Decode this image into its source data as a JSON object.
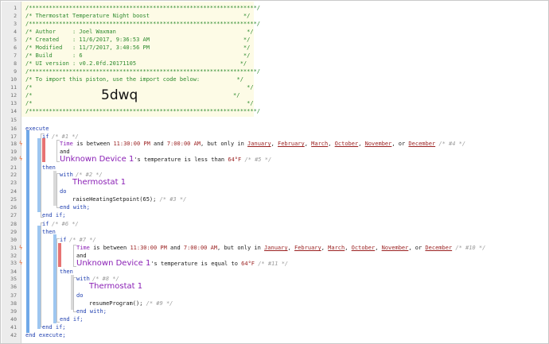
{
  "header": {
    "rule": "/********************************************************************/",
    "title": "/* Thermostat Temperature Night boost                            */",
    "author": "/* Author     : Joel Waxman                                       */",
    "created": "/* Created    : 11/6/2017, 9:36:53 AM                            */",
    "modified": "/* Modified   : 11/7/2017, 3:40:56 PM                            */",
    "build": "/* Build      : 6                                                */",
    "ui_version": "/* UI version : v0.2.0fd.20171105                               */",
    "import_note": "/* To import this piston, use the import code below:           */",
    "blank": "/*                                                                */",
    "import_prefix": "/*",
    "import_suffix": "*/",
    "import_code": "5dwq"
  },
  "line_numbers": [
    "1",
    "2",
    "3",
    "4",
    "5",
    "6",
    "7",
    "8",
    "9",
    "10",
    "11",
    "12",
    "13",
    "14",
    "15",
    "16",
    "17",
    "18",
    "19",
    "20",
    "21",
    "22",
    "23",
    "24",
    "25",
    "26",
    "27",
    "28",
    "29",
    "30",
    "31",
    "32",
    "33",
    "34",
    "35",
    "36",
    "37",
    "38",
    "39",
    "40",
    "41",
    "42"
  ],
  "icons": {
    "bolt": "lightning-bolt-icon",
    "bolt_glyph": "ϟ"
  },
  "code": {
    "execute": "execute",
    "end_execute": "end execute;",
    "if1": "if",
    "if1_c": "/* #1 */",
    "time_kw": "Time",
    "is_between": " is between ",
    "t_start": "11:30:00 PM",
    "and_txt": " and ",
    "t_end": "7:00:00 AM",
    "only_in": ", but only in ",
    "m1": "January",
    "m2": "February",
    "m3": "March",
    "m4": "October",
    "m5": "November",
    "or_txt": ", or ",
    "m6": "December",
    "comma": ", ",
    "c4": "/* #4 */",
    "and": "and",
    "device": "Unknown Device 1",
    "temp_less": "'s temperature is less than ",
    "temp_eq": "'s temperature is equal to ",
    "val64": "64°F",
    "c5": "/* #5 */",
    "then": "then",
    "with": "with",
    "c2": "/* #2 */",
    "thermostat": "Thermostat 1",
    "do": "do",
    "raise": "raiseHeatingSetpoint(65);",
    "c3": "/* #3 */",
    "end_with": "end with;",
    "end_if": "end if;",
    "if6": "if",
    "c6": "/* #6 */",
    "if7": "if",
    "c7": "/* #7 */",
    "c10": "/* #10 */",
    "c11": "/* #11 */",
    "with8": "with",
    "c8": "/* #8 */",
    "resume": "resumeProgram();",
    "c9": "/* #9 */"
  },
  "colors": {
    "keyword": "#1f3fb0",
    "comment": "#9a9a9a",
    "device": "#8a1fb5",
    "value": "#9b2222",
    "header_green": "#2d8a2d",
    "stripe_blue": "#6fa8e8",
    "stripe_red": "#e77373"
  }
}
